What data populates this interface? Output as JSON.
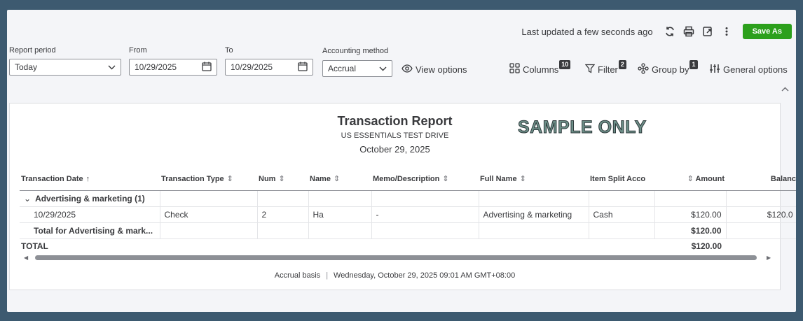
{
  "header": {
    "last_updated": "Last updated a few seconds ago",
    "save_as_label": "Save As"
  },
  "filters": {
    "report_period_label": "Report period",
    "report_period_value": "Today",
    "from_label": "From",
    "from_value": "10/29/2025",
    "to_label": "To",
    "to_value": "10/29/2025",
    "accounting_method_label": "Accounting method",
    "accounting_method_value": "Accrual"
  },
  "toolbar": {
    "view_options": "View options",
    "columns_label": "Columns",
    "columns_count": "10",
    "filter_label": "Filter",
    "filter_count": "2",
    "group_by_label": "Group by",
    "group_by_count": "1",
    "general_options": "General options"
  },
  "report": {
    "title": "Transaction Report",
    "company": "US ESSENTIALS TEST DRIVE",
    "date": "October 29, 2025",
    "watermark": "SAMPLE ONLY",
    "columns": [
      "Transaction Date",
      "Transaction Type",
      "Num",
      "Name",
      "Memo/Description",
      "Full Name",
      "Item Split Acco",
      "Amount",
      "Balanc"
    ],
    "group_label": "Advertising & marketing (1)",
    "row": {
      "date": "10/29/2025",
      "type": "Check",
      "num": "2",
      "name": "Ha",
      "memo": "-",
      "full_name": "Advertising & marketing",
      "split": "Cash",
      "amount": "$120.00",
      "balance": "$120.0"
    },
    "group_total_label": "Total for Advertising & mark...",
    "group_total_amount": "$120.00",
    "total_label": "TOTAL",
    "total_amount": "$120.00",
    "footer_basis": "Accrual basis",
    "footer_timestamp": "Wednesday, October 29, 2025 09:01 AM GMT+08:00"
  },
  "colors": {
    "accent": "#2ca01c",
    "frame": "#3d5a70"
  }
}
